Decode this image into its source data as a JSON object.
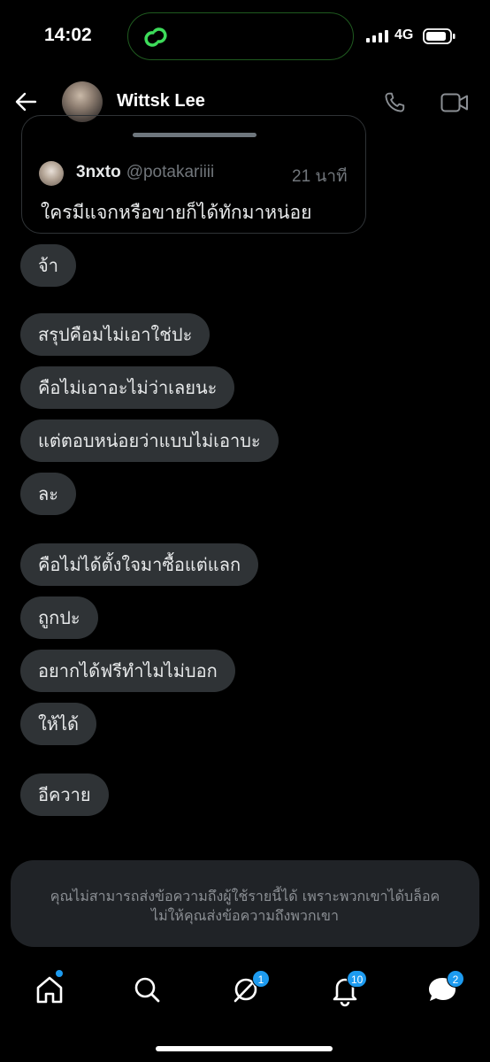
{
  "status_bar": {
    "time": "14:02",
    "network": "4G"
  },
  "header": {
    "contact_name": "Wittsk Lee"
  },
  "quoted_post": {
    "display_name": "3nxto",
    "handle": "@potakariiii",
    "time": "21 นาที",
    "text": "ใครมีแจกหรือขายก็ได้ทักมาหน่อย"
  },
  "messages": [
    "จ้า",
    "สรุปคือมไม่เอาใช่ปะ",
    "คือไม่เอาอะไม่ว่าเลยนะ",
    "แต่ตอบหน่อยว่าแบบไม่เอาบะ",
    "ละ",
    "คือไม่ได้ตั้งใจมาซื้อแต่แลก",
    "ถูกปะ",
    "อยากได้ฟรีทำไมไม่บอก",
    "ให้ได้",
    "อีควาย"
  ],
  "blocked_notice": {
    "line1": "คุณไม่สามารถส่งข้อความถึงผู้ใช้รายนี้ได้ เพราะพวกเขาได้บล็อค",
    "line2": "ไม่ให้คุณส่งข้อความถึงพวกเขา"
  },
  "tab_bar": {
    "icons": [
      "home-icon",
      "search-icon",
      "grok-icon",
      "bell-icon",
      "messages-icon"
    ],
    "badges": {
      "grok": "1",
      "notifications": "10",
      "messages": "2"
    }
  },
  "colors": {
    "accent": "#1d9bf0",
    "bubble": "#2f3336",
    "notice": "#202327",
    "island_border": "#1f5a1f"
  }
}
